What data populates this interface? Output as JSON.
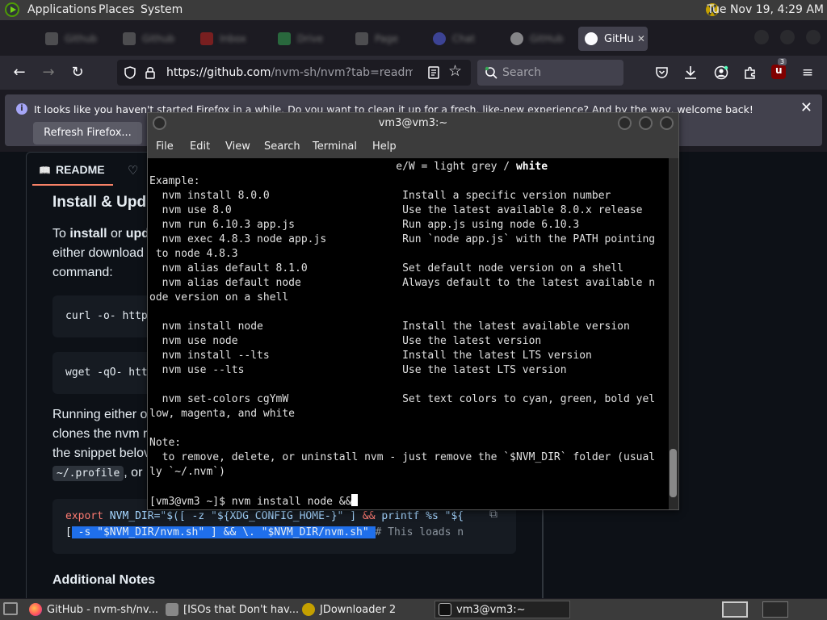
{
  "top_panel": {
    "menus": [
      "Applications",
      "Places",
      "System"
    ],
    "clock": "Tue Nov 19,  4:29 AM"
  },
  "browser": {
    "active_tab": {
      "label": "GitHu",
      "icon": "github-icon"
    },
    "inactive_tab_icons": [
      "page-icon",
      "page-icon",
      "gmail-icon",
      "drive-icon",
      "page-icon",
      "discord-icon",
      "github-icon"
    ],
    "url_host": "https://github.com",
    "url_path": "/nvm-sh/nvm?tab=readme-ov-f",
    "search_placeholder": "Search",
    "notification": {
      "message": "It looks like you haven't started Firefox in a while. Do you want to clean it up for a fresh, like-new experience? And by the way, welcome back!",
      "button": "Refresh Firefox..."
    },
    "extension_badge": "3"
  },
  "page": {
    "tabs": {
      "readme": "README"
    },
    "heading": "Install & Upd",
    "para1": [
      {
        "before": "To ",
        "bold1": "install",
        "mid": " or ",
        "bold2": "upd"
      },
      "either download",
      "command:"
    ],
    "code1": "curl -o- http",
    "code2": "wget -qO- htt",
    "para2": [
      "Running either o",
      "clones the nvm r",
      "the snippet belov"
    ],
    "para2_last_code": "~/.profile",
    "para2_last_text": ", or",
    "export_line": {
      "kw": "export",
      "var": " NVM_DIR=\"$([ -z \"${XDG_CONFIG_HOME-}\" ] ",
      "amp": "&&",
      "tail": " printf %s \"${"
    },
    "source_line": {
      "pre": "[",
      "sel": " -s \"$NVM_DIR/nvm.sh\" ] && \\. \"$NVM_DIR/nvm.sh\" ",
      "cm": "# This loads n"
    },
    "subheading": "Additional Notes"
  },
  "terminal": {
    "title": "vm3@vm3:~",
    "menu": [
      "File",
      "Edit",
      "View",
      "Search",
      "Terminal",
      "Help"
    ],
    "lines": [
      "                                       e/W = light grey / <b>white</b>",
      "Example:",
      "  nvm install 8.0.0                     Install a specific version number",
      "  nvm use 8.0                           Use the latest available 8.0.x release",
      "  nvm run 6.10.3 app.js                 Run app.js using node 6.10.3",
      "  nvm exec 4.8.3 node app.js            Run `node app.js` with the PATH pointing",
      " to node 4.8.3",
      "  nvm alias default 8.1.0               Set default node version on a shell",
      "  nvm alias default node                Always default to the latest available n",
      "ode version on a shell",
      "",
      "  nvm install node                      Install the latest available version",
      "  nvm use node                          Use the latest version",
      "  nvm install --lts                     Install the latest LTS version",
      "  nvm use --lts                         Use the latest LTS version",
      "",
      "  nvm set-colors cgYmW                  Set text colors to cyan, green, bold yel",
      "low, magenta, and white",
      "",
      "Note:",
      "  to remove, delete, or uninstall nvm - just remove the `$NVM_DIR` folder (usual",
      "ly `~/.nvm`)",
      ""
    ],
    "prompt": "[vm3@vm3 ~]$ nvm install node &&"
  },
  "taskbar": {
    "tasks": [
      {
        "label": "GitHub - nvm-sh/nv...",
        "icon": "firefox-icon"
      },
      {
        "label": "[ISOs that Don't hav...",
        "icon": "folder-icon"
      },
      {
        "label": "JDownloader 2",
        "icon": "jdownloader-icon"
      },
      {
        "label": "vm3@vm3:~",
        "icon": "terminal-icon"
      }
    ]
  },
  "colors": {
    "panel": "#3b3b3b",
    "firefox_bg": "#1c1b22",
    "github_bg": "#0d1117",
    "terminal_bg": "#000000",
    "selection": "#1f6feb"
  }
}
